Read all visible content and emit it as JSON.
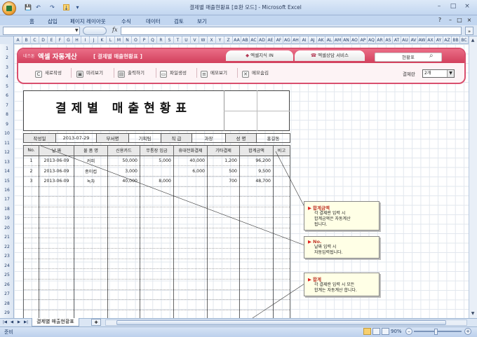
{
  "window": {
    "title": "결제별 매출현황표 [호환 모드] - Microsoft Excel",
    "minimize": "–",
    "restore": "□",
    "close": "×"
  },
  "quick_access": {
    "save": "💾",
    "undo": "↶",
    "redo": "↷",
    "highlighted": "↓",
    "customize": "▾"
  },
  "ribbon": {
    "tabs": [
      "홈",
      "삽입",
      "페이지 레이아웃",
      "수식",
      "데이터",
      "검토",
      "보기"
    ],
    "help": "?",
    "app_min": "–",
    "app_restore": "□",
    "app_close": "×"
  },
  "formula_bar": {
    "fx": "fx",
    "value": "",
    "expand": "»"
  },
  "columns": [
    "A",
    "B",
    "C",
    "D",
    "E",
    "F",
    "G",
    "H",
    "I",
    "J",
    "K",
    "L",
    "M",
    "N",
    "O",
    "P",
    "Q",
    "R",
    "S",
    "T",
    "U",
    "V",
    "W",
    "X",
    "Y",
    "Z",
    "AA",
    "AB",
    "AC",
    "AD",
    "AE",
    "AF",
    "AG",
    "AH",
    "AI",
    "AJ",
    "AK",
    "AL",
    "AM",
    "AN",
    "AO",
    "AP",
    "AQ",
    "AR",
    "AS",
    "AT",
    "AU",
    "AV",
    "AW",
    "AX",
    "AY",
    "AZ",
    "BB",
    "BC"
  ],
  "rows": [
    "1",
    "2",
    "3",
    "4",
    "5",
    "6",
    "7",
    "8",
    "9",
    "10",
    "11",
    "12",
    "13",
    "14",
    "15",
    "16",
    "17",
    "18",
    "19",
    "20",
    "21",
    "22",
    "23",
    "24",
    "25",
    "26",
    "27",
    "28",
    "29"
  ],
  "banner": {
    "brand_small": "네즈톤",
    "brand_name": "엑셀 자동계산",
    "subtitle": "[ 결제별 매출현황표 ]",
    "top_buttons": [
      {
        "icon": "◆",
        "label": "엑셀지식 IN"
      },
      {
        "icon": "☎",
        "label": "엑셀상담 서비스"
      }
    ],
    "search_text": "현황표",
    "tools": [
      {
        "icon": "C",
        "label": "새로작성"
      },
      {
        "icon": "▣",
        "label": "미리보기"
      },
      {
        "icon": "▤",
        "label": "출력하기"
      },
      {
        "icon": "▭",
        "label": "파일생성"
      },
      {
        "icon": "≡",
        "label": "메모보기"
      },
      {
        "icon": "✕",
        "label": "메모숨김"
      }
    ],
    "pay_type_label": "결제란",
    "pay_type_value": "2개"
  },
  "report": {
    "title": "결제별 매출현황표",
    "info": {
      "written_label": "작성일",
      "written_value": "2013-07-29",
      "dept_label": "부서명",
      "dept_value": "기획팀",
      "position_label": "직 급",
      "position_value": "과장",
      "name_label": "성 명",
      "name_value": "홍길동"
    },
    "headers": [
      "No.",
      "날 짜",
      "물 품 명",
      "신용카드",
      "무통장 입금",
      "휴대전화결제",
      "기타결제",
      "합계금액",
      "비고"
    ],
    "items": [
      [
        "1",
        "2013-06-09",
        "커피",
        "50,000",
        "5,000",
        "40,000",
        "1,200",
        "96,200",
        ""
      ],
      [
        "2",
        "2013-06-09",
        "종이컵",
        "3,000",
        "",
        "6,000",
        "500",
        "9,500",
        ""
      ],
      [
        "3",
        "2013-06-09",
        "녹차",
        "40,000",
        "8,000",
        "",
        "700",
        "48,700",
        ""
      ]
    ],
    "empty_rows": 14
  },
  "callouts": [
    {
      "title": "합계금액",
      "lines": [
        "각 결제란 입력 시",
        "합계금액은 자동계산",
        "됩니다."
      ]
    },
    {
      "title": "No.",
      "lines": [
        "날짜 입력 시",
        "자동입력됩니다."
      ]
    },
    {
      "title": "합계",
      "lines": [
        "각 결제란 입력 시 모든",
        "합계는 자동계산 합니다."
      ]
    }
  ],
  "sheet_tabs": {
    "nav": [
      "|◀",
      "◀",
      "▶",
      "▶|"
    ],
    "active": "결제별 매출현황표",
    "new_sheet": "✚"
  },
  "status": {
    "ready": "준비",
    "zoom": "90%",
    "zoom_level": 0.45,
    "minus": "–",
    "plus": "+"
  }
}
